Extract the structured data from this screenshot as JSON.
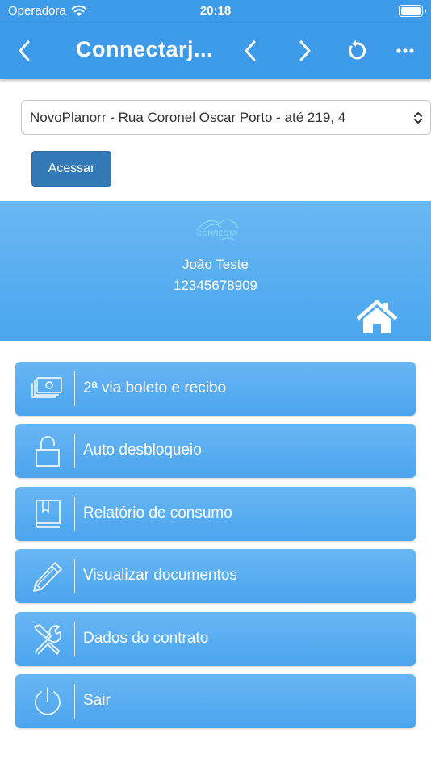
{
  "status_bar": {
    "carrier": "Operadora",
    "time": "20:18"
  },
  "nav": {
    "title": "Connectarj..."
  },
  "select": {
    "value": "NovoPlanorr - Rua Coronel Oscar Porto - até 219, 4"
  },
  "access_button": {
    "label": "Acessar"
  },
  "profile": {
    "logo_text": "CONNECTA",
    "name": "João Teste",
    "id": "12345678909"
  },
  "menu": [
    {
      "label": "2ª via boleto e recibo",
      "icon": "cash-icon"
    },
    {
      "label": "Auto desbloqueio",
      "icon": "unlock-icon"
    },
    {
      "label": "Relatório de consumo",
      "icon": "book-icon"
    },
    {
      "label": "Visualizar documentos",
      "icon": "pencil-icon"
    },
    {
      "label": "Dados do contrato",
      "icon": "tools-icon"
    },
    {
      "label": "Sair",
      "icon": "power-icon"
    }
  ],
  "colors": {
    "header": "#3d9be9",
    "accent_button": "#337ab7",
    "menu_item": "#56acf0"
  }
}
